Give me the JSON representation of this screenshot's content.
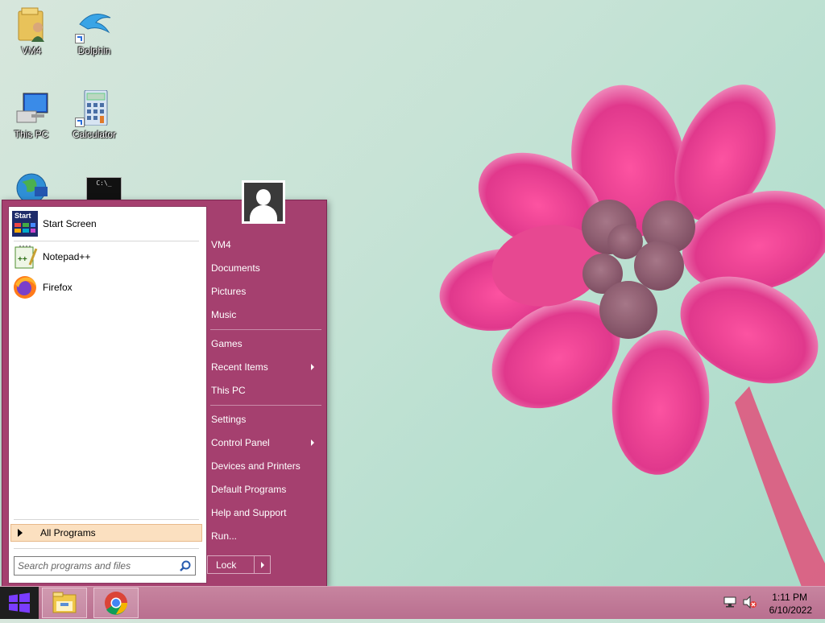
{
  "desktop": {
    "icons": [
      {
        "label": "VM4"
      },
      {
        "label": "Dolphin"
      },
      {
        "label": "This PC"
      },
      {
        "label": "Calculator"
      }
    ]
  },
  "start_menu": {
    "pinned": [
      {
        "label": "Start Screen",
        "icon": "start-screen-icon",
        "icon_text": "Start"
      },
      {
        "label": "Notepad++",
        "icon": "notepad-plus-plus-icon"
      },
      {
        "label": "Firefox",
        "icon": "firefox-icon"
      }
    ],
    "all_programs": "All Programs",
    "search": {
      "placeholder": "Search programs and files"
    },
    "places": [
      {
        "label": "VM4"
      },
      {
        "label": "Documents"
      },
      {
        "label": "Pictures"
      },
      {
        "label": "Music"
      },
      {
        "label": "Games"
      },
      {
        "label": "Recent Items",
        "submenu": true
      },
      {
        "label": "This PC"
      },
      {
        "label": "Settings"
      },
      {
        "label": "Control Panel",
        "submenu": true
      },
      {
        "label": "Devices and Printers"
      },
      {
        "label": "Default Programs"
      },
      {
        "label": "Help and Support"
      },
      {
        "label": "Run..."
      }
    ],
    "lock_label": "Lock",
    "cmd_icon_text": "C:\\_"
  },
  "taskbar": {
    "apps": [
      {
        "name": "file-explorer-icon"
      },
      {
        "name": "chrome-icon"
      }
    ],
    "tray": {
      "time": "1:11 PM",
      "date": "6/10/2022"
    }
  },
  "colors": {
    "menu_bg": "#a5406f",
    "taskbar": "#be7796",
    "all_programs_highlight": "#fbe0c0"
  }
}
